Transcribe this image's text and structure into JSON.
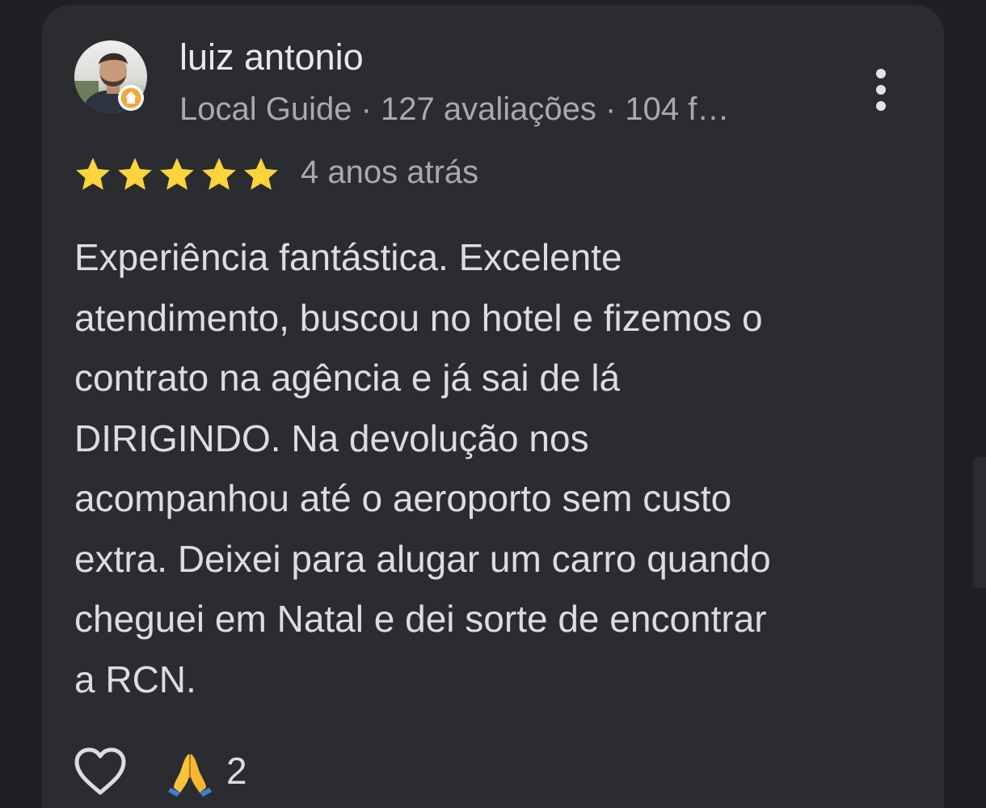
{
  "review": {
    "reviewer": {
      "name": "luiz antonio",
      "meta": "Local Guide · 127 avaliações · 104 f…",
      "avatar": "profile-photo",
      "badge": "local-guide-badge"
    },
    "rating": 5,
    "max_rating": 5,
    "date": "4 anos atrás",
    "text": "Experiência fantástica. Excelente\natendimento, buscou no hotel e fizemos o\ncontrato na agência e já sai de lá\nDIRIGINDO. Na devolução nos\nacompanhou até o aeroporto sem custo\nextra. Deixei para alugar um carro quando\ncheguei em Natal e dei sorte de encontrar\na RCN.",
    "reactions": {
      "like_icon": "heart-outline-icon",
      "emoji": "folded-hands-emoji",
      "count": "2"
    },
    "menu_icon": "more-vertical-icon"
  },
  "colors": {
    "background": "#1f2023",
    "card": "#2b2c30",
    "star": "#fbd43b",
    "primary_text": "#dcdde0",
    "secondary_text": "#a9aaae"
  }
}
